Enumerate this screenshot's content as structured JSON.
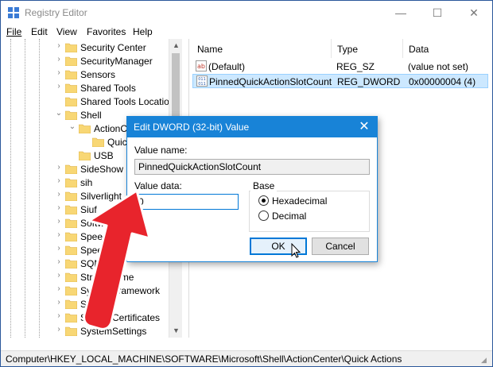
{
  "window": {
    "title": "Registry Editor",
    "controls": {
      "minimize": "—",
      "maximize": "☐",
      "close": "✕"
    }
  },
  "menu": [
    "File",
    "Edit",
    "View",
    "Favorites",
    "Help"
  ],
  "tree": {
    "items": [
      {
        "label": "Security Center",
        "level": 0,
        "chevron": "›"
      },
      {
        "label": "SecurityManager",
        "level": 0,
        "chevron": "›"
      },
      {
        "label": "Sensors",
        "level": 0,
        "chevron": "›"
      },
      {
        "label": "Shared Tools",
        "level": 0,
        "chevron": "›"
      },
      {
        "label": "Shared Tools Location",
        "level": 0,
        "chevron": ""
      },
      {
        "label": "Shell",
        "level": 0,
        "chevron": "⌄"
      },
      {
        "label": "ActionC",
        "level": 1,
        "chevron": "⌄"
      },
      {
        "label": "Quic",
        "level": 2,
        "chevron": ""
      },
      {
        "label": "USB",
        "level": 1,
        "chevron": ""
      },
      {
        "label": "SideShow",
        "level": 0,
        "chevron": "›"
      },
      {
        "label": "sih",
        "level": 0,
        "chevron": "›"
      },
      {
        "label": "Silverlight",
        "level": 0,
        "chevron": "›"
      },
      {
        "label": "Siuf",
        "level": 0,
        "chevron": "›"
      },
      {
        "label": "Software",
        "level": 0,
        "chevron": "›"
      },
      {
        "label": "Speech",
        "level": 0,
        "chevron": "›"
      },
      {
        "label": "Speech",
        "level": 0,
        "chevron": "›"
      },
      {
        "label": "SQMC",
        "level": 0,
        "chevron": "›"
      },
      {
        "label": "StrongName",
        "level": 0,
        "chevron": "›"
      },
      {
        "label": "SystemFramework",
        "level": 0,
        "chevron": "›"
      },
      {
        "label": "Sysprep",
        "level": 0,
        "chevron": "›"
      },
      {
        "label": "SystemCertificates",
        "level": 0,
        "chevron": "›"
      },
      {
        "label": "SystemSettings",
        "level": 0,
        "chevron": "›"
      }
    ]
  },
  "list": {
    "columns": [
      "Name",
      "Type",
      "Data"
    ],
    "rows": [
      {
        "name": "(Default)",
        "type": "REG_SZ",
        "data": "(value not set)",
        "icon": "string-value-icon",
        "icon_text": "ab"
      },
      {
        "name": "PinnedQuickActionSlotCount",
        "type": "REG_DWORD",
        "data": "0x00000004 (4)",
        "icon": "binary-value-icon",
        "icon_text": "011"
      }
    ]
  },
  "status": {
    "path": "Computer\\HKEY_LOCAL_MACHINE\\SOFTWARE\\Microsoft\\Shell\\ActionCenter\\Quick Actions"
  },
  "dialog": {
    "title": "Edit DWORD (32-bit) Value",
    "close": "✕",
    "value_name_label": "Value name:",
    "value_name": "PinnedQuickActionSlotCount",
    "value_data_label": "Value data:",
    "value_data": "0",
    "base_label": "Base",
    "base_options": [
      {
        "label": "Hexadecimal",
        "checked": true
      },
      {
        "label": "Decimal",
        "checked": false
      }
    ],
    "ok_label": "OK",
    "cancel_label": "Cancel"
  },
  "colors": {
    "accent": "#1883d7",
    "selection": "#cce8ff",
    "folder": "#f8d775",
    "arrow": "#e8242c"
  },
  "icons": {
    "app": "registry-editor-icon",
    "folder": "folder-icon",
    "cursor": "mouse-pointer-icon",
    "annotation": "red-arrow-annotation"
  }
}
